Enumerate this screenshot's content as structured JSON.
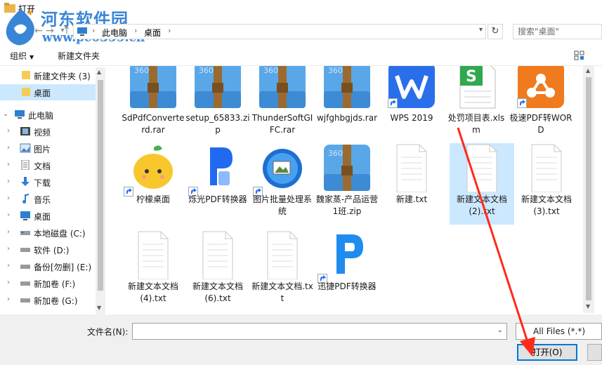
{
  "window": {
    "title": "打开"
  },
  "watermark": {
    "brand": "河东软件园",
    "url": "www.pc0359.cn"
  },
  "address": {
    "crumbs": [
      "此电脑",
      "桌面"
    ],
    "search_placeholder": "搜索\"桌面\""
  },
  "toolbar": {
    "organize": "组织",
    "new_folder": "新建文件夹"
  },
  "sidebar": {
    "items": [
      {
        "label": "新建文件夹 (3)",
        "icon": "folder-icon"
      },
      {
        "label": "桌面",
        "icon": "folder-icon"
      },
      {
        "label": "此电脑",
        "icon": "computer-icon"
      },
      {
        "label": "视频",
        "icon": "video-icon"
      },
      {
        "label": "图片",
        "icon": "picture-icon"
      },
      {
        "label": "文档",
        "icon": "document-icon"
      },
      {
        "label": "下载",
        "icon": "download-icon"
      },
      {
        "label": "音乐",
        "icon": "music-icon"
      },
      {
        "label": "桌面",
        "icon": "desktop-icon"
      },
      {
        "label": "本地磁盘 (C:)",
        "icon": "drive-icon"
      },
      {
        "label": "软件 (D:)",
        "icon": "drive-icon"
      },
      {
        "label": "备份[勿删] (E:)",
        "icon": "drive-icon"
      },
      {
        "label": "新加卷 (F:)",
        "icon": "drive-icon"
      },
      {
        "label": "新加卷 (G:)",
        "icon": "drive-icon"
      }
    ]
  },
  "files": [
    {
      "name": "SdPdfConverterd.rar",
      "icon": "rar-archive-icon"
    },
    {
      "name": "setup_65833.zip",
      "icon": "zip-archive-icon"
    },
    {
      "name": "ThunderSoftGIFC.rar",
      "icon": "rar-archive-icon"
    },
    {
      "name": "wjfghbgjds.rar",
      "icon": "rar-archive-icon"
    },
    {
      "name": "WPS 2019",
      "icon": "wps-icon"
    },
    {
      "name": "处罚项目表.xlsm",
      "icon": "spreadsheet-icon"
    },
    {
      "name": "极速PDF转WORD",
      "icon": "pdf-to-word-icon"
    },
    {
      "name": "柠檬桌面",
      "icon": "lemon-desktop-icon"
    },
    {
      "name": "烁光PDF转换器",
      "icon": "pdf-converter-icon"
    },
    {
      "name": "图片批量处理系统",
      "icon": "image-batch-icon"
    },
    {
      "name": "魏家蒸-产品运营1班.zip",
      "icon": "zip-archive-icon"
    },
    {
      "name": "新建.txt",
      "icon": "text-file-icon"
    },
    {
      "name": "新建文本文档(2).txt",
      "icon": "text-file-icon"
    },
    {
      "name": "新建文本文档(3).txt",
      "icon": "text-file-icon"
    },
    {
      "name": "新建文本文档(4).txt",
      "icon": "text-file-icon"
    },
    {
      "name": "新建文本文档(6).txt",
      "icon": "text-file-icon"
    },
    {
      "name": "新建文本文档.txt",
      "icon": "text-file-icon"
    },
    {
      "name": "迅捷PDF转换器",
      "icon": "pdf-converter-icon"
    }
  ],
  "footer": {
    "filename_label": "文件名(N):",
    "filename_value": "",
    "filter": "All Files (*.*)",
    "open_button": "打开(O)"
  },
  "colors": {
    "accent": "#0078d7",
    "selection": "#cce8ff",
    "annotation": "#ff2a1a"
  }
}
